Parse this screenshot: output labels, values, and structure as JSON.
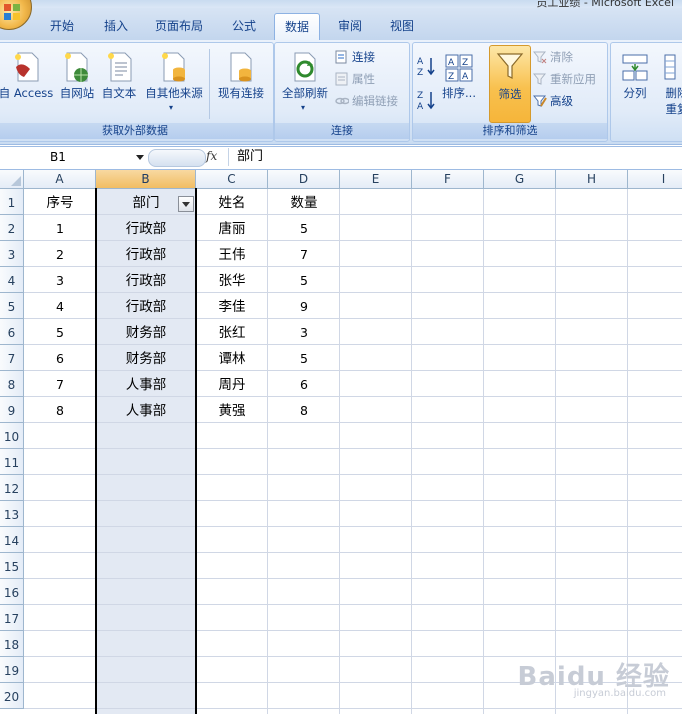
{
  "window": {
    "title": "员工业绩 - Microsoft Excel"
  },
  "tabs": [
    {
      "label": "开始",
      "active": false
    },
    {
      "label": "插入",
      "active": false
    },
    {
      "label": "页面布局",
      "active": false
    },
    {
      "label": "公式",
      "active": false
    },
    {
      "label": "数据",
      "active": true
    },
    {
      "label": "审阅",
      "active": false
    },
    {
      "label": "视图",
      "active": false
    }
  ],
  "ribbon": {
    "external": {
      "label": "获取外部数据",
      "from_access": "自 Access",
      "from_web": "自网站",
      "from_text": "自文本",
      "from_other": "自其他来源",
      "existing": "现有连接"
    },
    "connections": {
      "label": "连接",
      "refresh_all": "全部刷新",
      "connections": "连接",
      "properties": "属性",
      "edit_links": "编辑链接"
    },
    "sort_filter": {
      "label": "排序和筛选",
      "sort": "排序...",
      "filter": "筛选",
      "clear": "清除",
      "reapply": "重新应用",
      "advanced": "高级"
    },
    "tools": {
      "text_to_columns": "分列",
      "remove_dup_line1": "删除",
      "remove_dup_line2": "重复"
    }
  },
  "formula_bar": {
    "name_box": "B1",
    "fx": "fx",
    "value": "部门"
  },
  "sheet": {
    "columns": [
      "A",
      "B",
      "C",
      "D",
      "E",
      "F",
      "G",
      "H",
      "I"
    ],
    "selected_column": "B",
    "rows": [
      "1",
      "2",
      "3",
      "4",
      "5",
      "6",
      "7",
      "8",
      "9",
      "10",
      "11",
      "12",
      "13",
      "14",
      "15",
      "16",
      "17",
      "18",
      "19",
      "20"
    ],
    "headers": [
      "序号",
      "部门",
      "姓名",
      "数量"
    ],
    "data": [
      [
        "1",
        "行政部",
        "唐丽",
        "5"
      ],
      [
        "2",
        "行政部",
        "王伟",
        "7"
      ],
      [
        "3",
        "行政部",
        "张华",
        "5"
      ],
      [
        "4",
        "行政部",
        "李佳",
        "9"
      ],
      [
        "5",
        "财务部",
        "张红",
        "3"
      ],
      [
        "6",
        "财务部",
        "谭林",
        "5"
      ],
      [
        "7",
        "人事部",
        "周丹",
        "6"
      ],
      [
        "8",
        "人事部",
        "黄强",
        "8"
      ]
    ]
  },
  "watermark": {
    "main": "Baidu 经验",
    "sub": "jingyan.baidu.com"
  },
  "colors": {
    "accent": "#15428b",
    "selection": "#e3e9f3",
    "filter_active": "#f8c14f"
  }
}
